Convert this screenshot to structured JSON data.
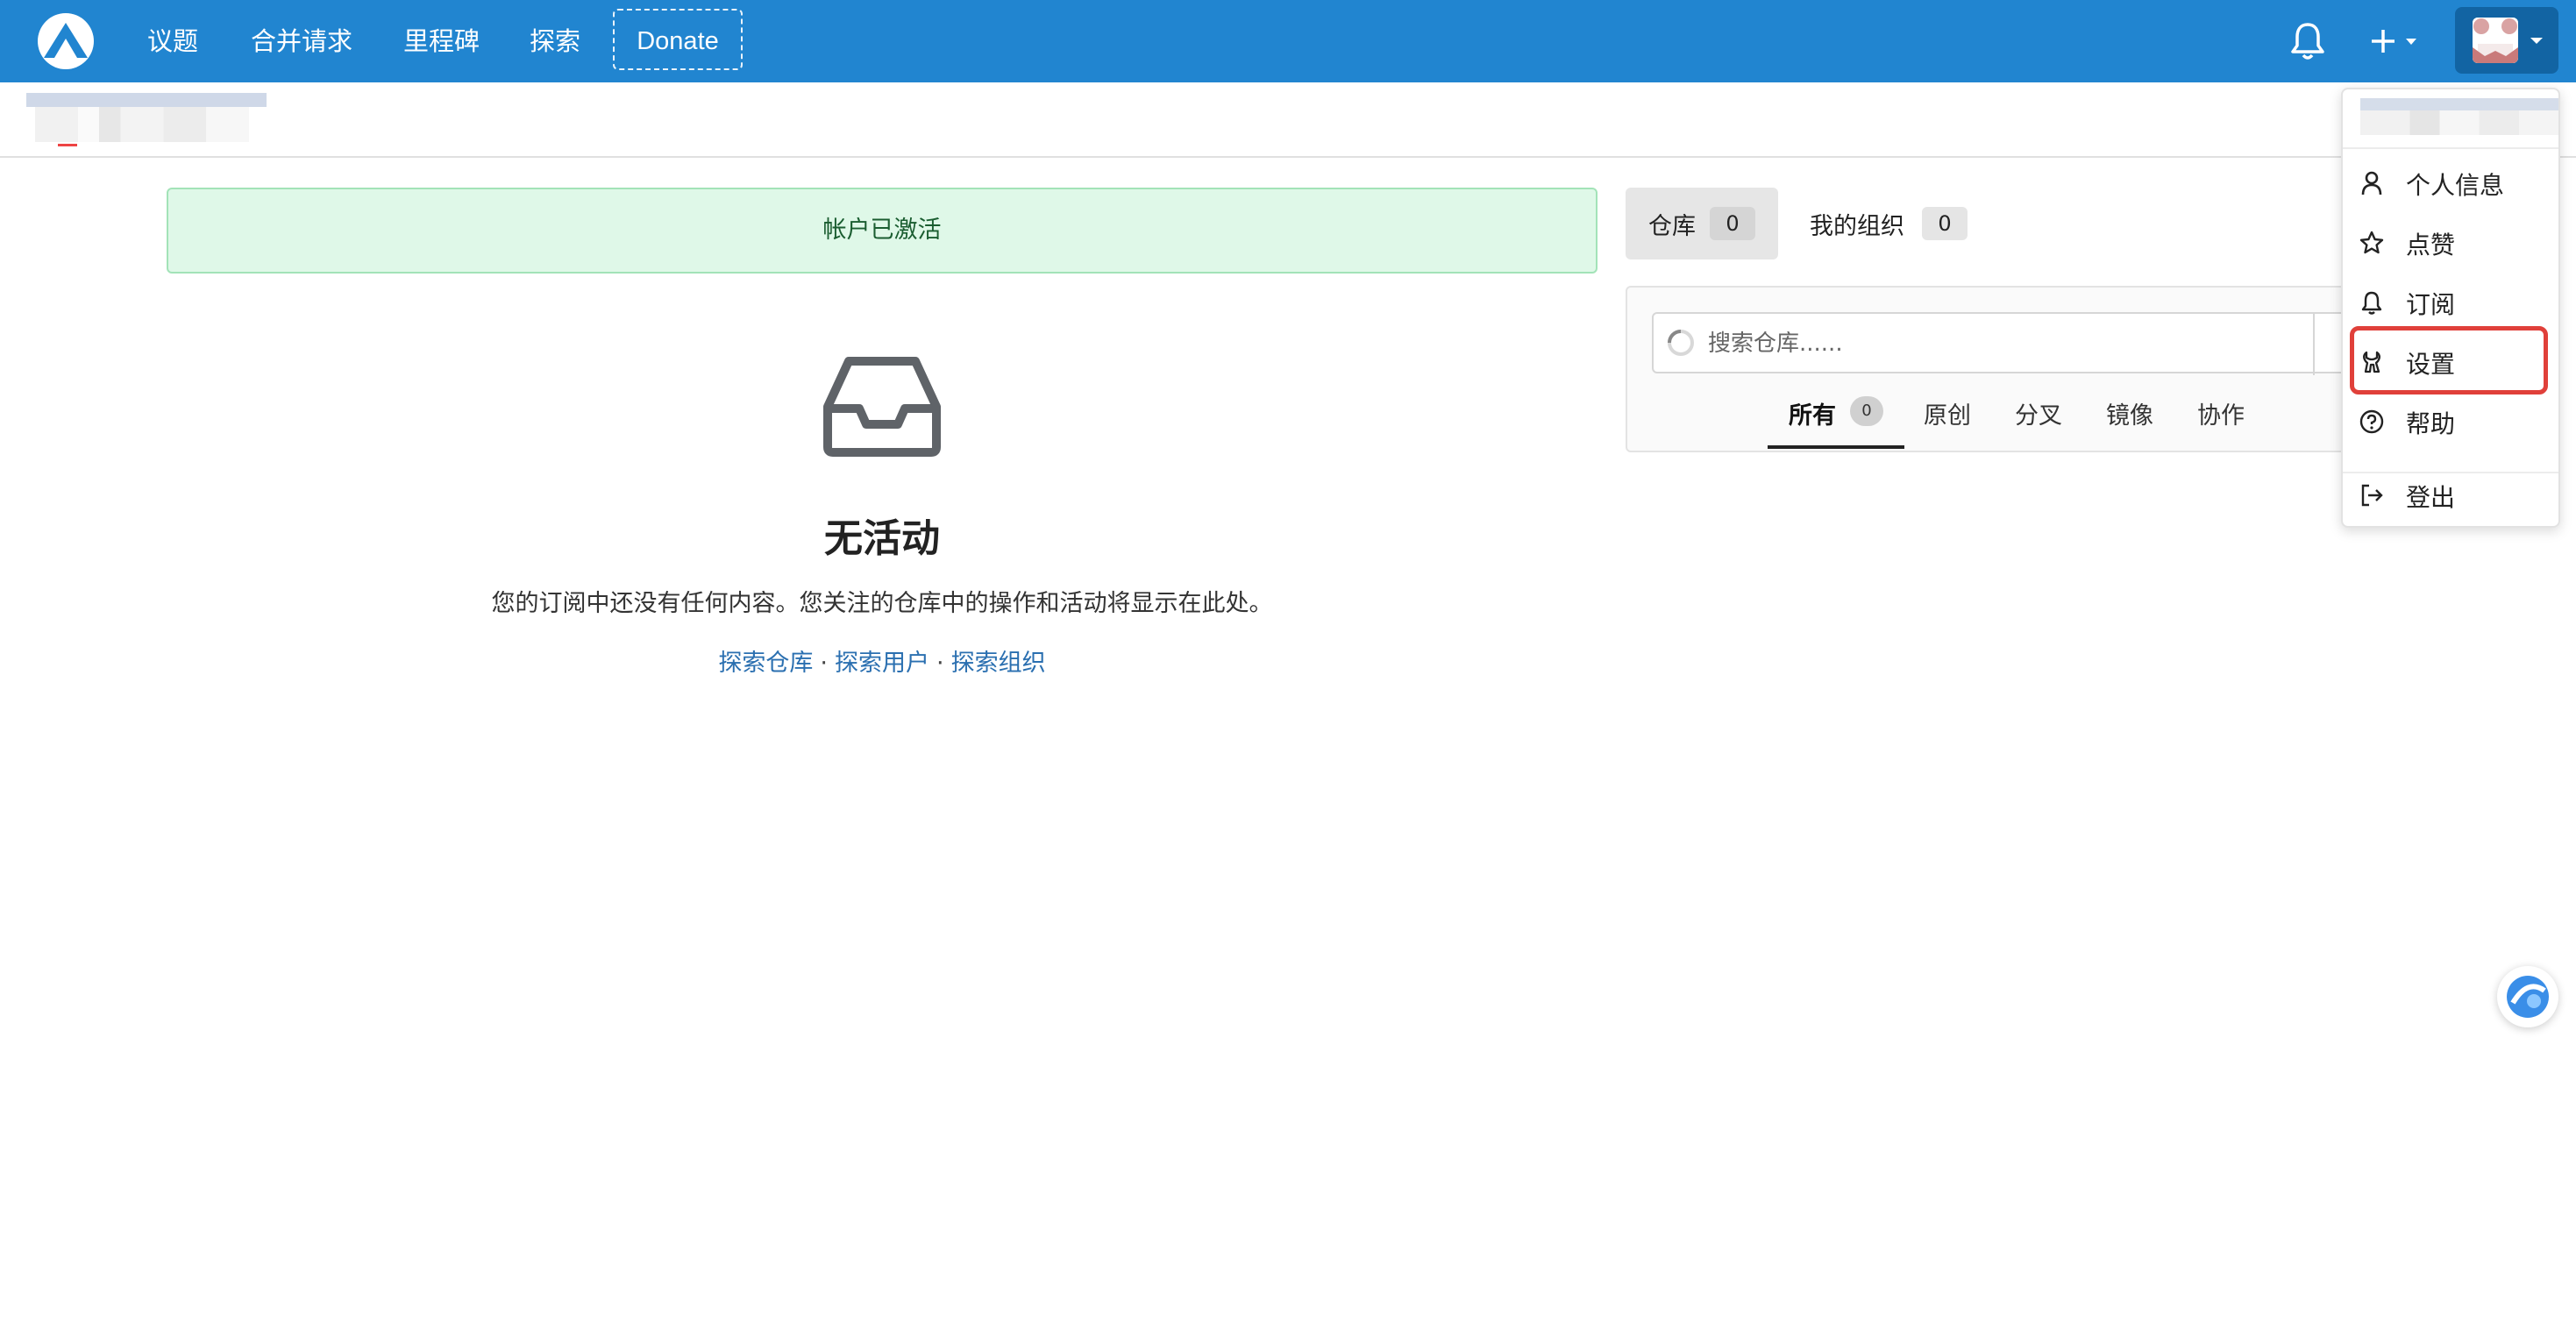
{
  "nav": {
    "items": [
      "议题",
      "合并请求",
      "里程碑",
      "探索"
    ],
    "donate": "Donate"
  },
  "flash": {
    "message": "帐户已激活"
  },
  "feed": {
    "empty_title": "无活动",
    "empty_desc": "您的订阅中还没有任何内容。您关注的仓库中的操作和活动将显示在此处。",
    "links": [
      "探索仓库",
      "探索用户",
      "探索组织"
    ],
    "separator": "·"
  },
  "dashboard": {
    "tabs": [
      {
        "label": "仓库",
        "count": "0"
      },
      {
        "label": "我的组织",
        "count": "0"
      }
    ],
    "search_placeholder": "搜索仓库......",
    "filters": [
      {
        "label": "所有",
        "count": "0"
      },
      {
        "label": "原创"
      },
      {
        "label": "分叉"
      },
      {
        "label": "镜像"
      },
      {
        "label": "协作"
      }
    ]
  },
  "user_menu": {
    "items": [
      "个人信息",
      "点赞",
      "订阅",
      "设置",
      "帮助",
      "登出"
    ],
    "highlighted": "设置"
  },
  "colors": {
    "nav_bg": "#2185d0",
    "flash_bg": "#dff8e8",
    "link": "#2a6fb0",
    "highlight": "#e0403a"
  }
}
